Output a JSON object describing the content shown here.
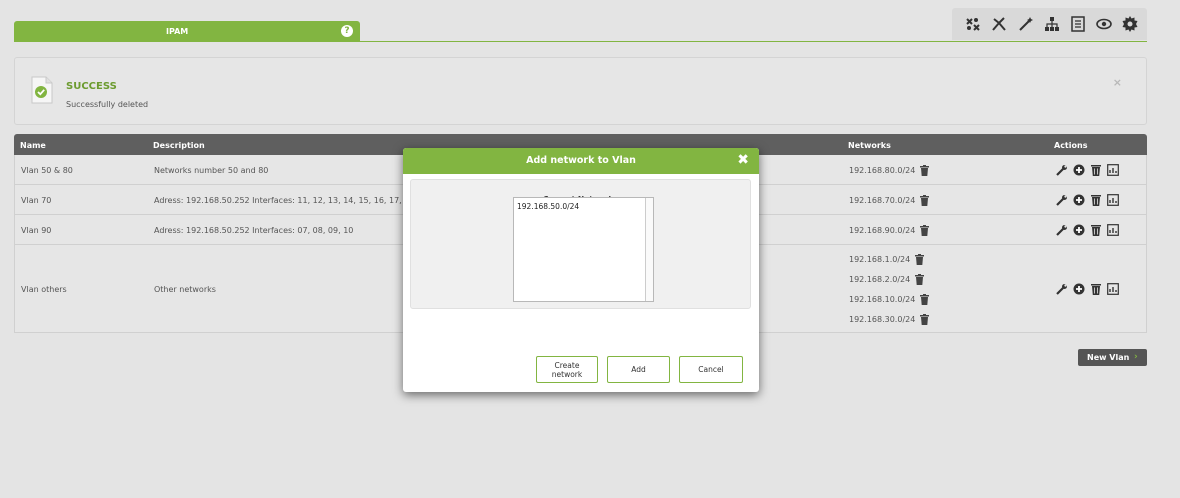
{
  "tab": {
    "title": "IPAM",
    "help_icon": "?"
  },
  "toolbar": {
    "icons": [
      "network-tools-icon",
      "antenna-icon",
      "magic-wand-icon",
      "hierarchy-icon",
      "list-icon",
      "eye-icon",
      "gear-icon"
    ]
  },
  "alert": {
    "title": "SUCCESS",
    "message": "Successfully deleted",
    "close": "×"
  },
  "table": {
    "headers": {
      "name": "Name",
      "description": "Description",
      "networks": "Networks",
      "actions": "Actions"
    },
    "rows": [
      {
        "name": "Vlan 50 & 80",
        "description": "Networks number 50 and 80",
        "networks": [
          "192.168.80.0/24"
        ]
      },
      {
        "name": "Vlan 70",
        "description": "Adress: 192.168.50.252 Interfaces: 11, 12, 13, 14, 15, 16, 17,",
        "networks": [
          "192.168.70.0/24"
        ]
      },
      {
        "name": "Vlan 90",
        "description": "Adress: 192.168.50.252 Interfaces: 07, 08, 09, 10",
        "networks": [
          "192.168.90.0/24"
        ]
      },
      {
        "name": "Vlan others",
        "description": "Other networks",
        "networks": [
          "192.168.1.0/24",
          "192.168.2.0/24",
          "192.168.10.0/24",
          "192.168.30.0/24"
        ]
      }
    ]
  },
  "new_vlan_button": {
    "label": "New Vlan",
    "chevron": "›"
  },
  "modal": {
    "title": "Add network to Vlan",
    "close": "✖",
    "current_networks_label": "Current Networks",
    "current_networks": [
      "192.168.50.0/24"
    ],
    "buttons": {
      "create_network_line1": "Create",
      "create_network_line2": "network",
      "add": "Add",
      "cancel": "Cancel"
    }
  },
  "colors": {
    "accent": "#82b541",
    "header_dark": "#5f5f5f",
    "background": "#e4e4e4"
  }
}
